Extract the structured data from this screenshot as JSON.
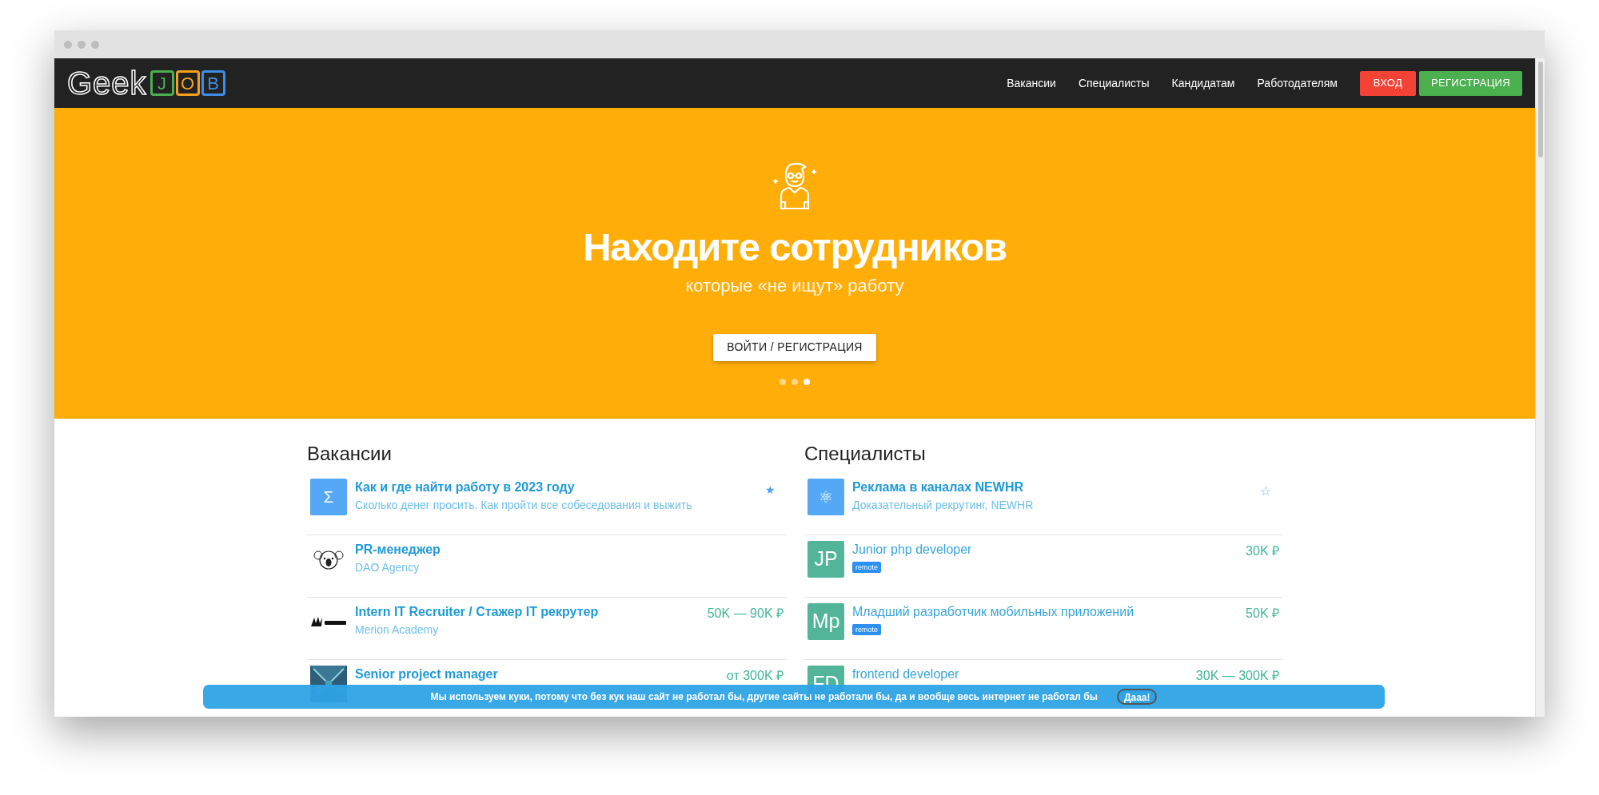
{
  "logo": {
    "word": "Geek",
    "letters": [
      {
        "char": "J",
        "color": "#4caf50"
      },
      {
        "char": "O",
        "color": "#f7a11a"
      },
      {
        "char": "B",
        "color": "#3d8ee6"
      }
    ]
  },
  "nav": [
    "Вакансии",
    "Специалисты",
    "Кандидатам",
    "Работодателям"
  ],
  "auth_buttons": [
    {
      "label": "ВХОД",
      "kind": "login"
    },
    {
      "label": "РЕГИСТРАЦИЯ",
      "kind": "signup"
    }
  ],
  "hero": {
    "title": "Находите сотрудников",
    "subtitle": "которые «не ищут» работу",
    "button": "ВОЙТИ / РЕГИСТРАЦИЯ",
    "slides": [
      {
        "selected": false
      },
      {
        "selected": false
      },
      {
        "selected": true
      }
    ]
  },
  "sections": [
    {
      "heading": "Вакансии",
      "items": [
        {
          "kind": "glyph",
          "glyph": "Σ",
          "title": "Как и где найти работу в 2023 году",
          "subtitle": "Сколько денег просить. Как пройти все собеседования и выжить",
          "promo": true,
          "star": "★",
          "starred": true
        },
        {
          "kind": "emblem",
          "title": "PR-менеджер",
          "subtitle": "DAO Agency",
          "promo": true
        },
        {
          "kind": "banner",
          "title": "Intern IT Recruiter / Стажер IT рекрутер",
          "subtitle": "Merion Academy",
          "salary": "50K — 90K ₽",
          "promo": true
        },
        {
          "kind": "picture",
          "title": "Senior project manager",
          "salary": "от 300K ₽",
          "promo": true
        }
      ]
    },
    {
      "heading": "Специалисты",
      "items": [
        {
          "kind": "glyph",
          "glyph": "⚛",
          "title": "Реклама в каналах NEWHR",
          "subtitle": "Доказательный рекрутинг, NEWHR",
          "promo": true,
          "star": "☆",
          "starred": false
        },
        {
          "kind": "initials",
          "initials": "JP",
          "title": "Junior php developer",
          "tags": [
            "remote"
          ],
          "salary": "30K ₽",
          "promo": false
        },
        {
          "kind": "initials",
          "initials": "Mp",
          "title": "Младший разработчик мобильных приложений",
          "tags": [
            "remote"
          ],
          "salary": "50K ₽",
          "promo": false
        },
        {
          "kind": "initials",
          "initials": "FD",
          "title": "frontend developer",
          "salary": "30K — 300K ₽",
          "promo": false
        }
      ]
    }
  ],
  "cookie": {
    "text": "Мы используем куки, потому что без кук наш сайт не работал бы, другие сайты не работали бы, да и вообще весь интернет не работал бы",
    "button": "Дааа!"
  }
}
